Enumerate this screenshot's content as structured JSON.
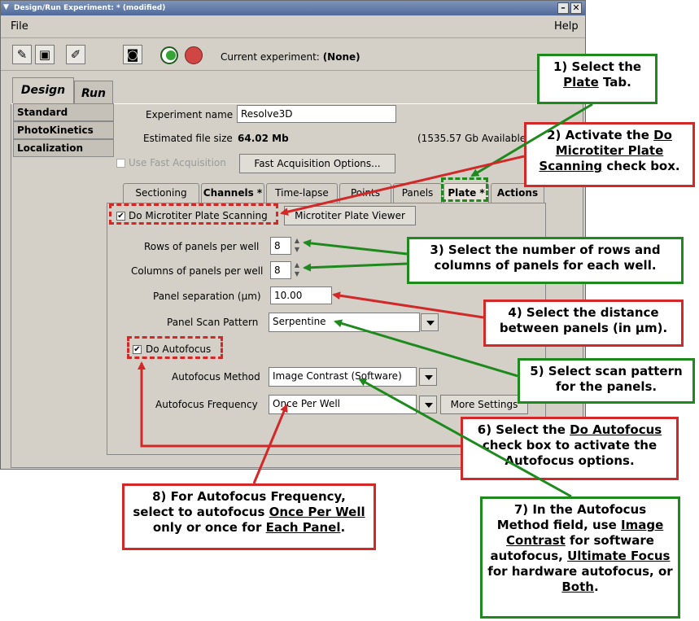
{
  "window": {
    "title": "Design/Run Experiment: * (modified)",
    "minimize": "–",
    "close": "✕"
  },
  "menu": {
    "file": "File",
    "help": "Help"
  },
  "toolbar": {
    "current_experiment_label": "Current experiment:",
    "current_experiment_value": "(None)"
  },
  "top_tabs": [
    "Design",
    "Run"
  ],
  "side_items": [
    "Standard",
    "PhotoKinetics",
    "Localization"
  ],
  "form": {
    "experiment_name_label": "Experiment name",
    "experiment_name_value": "Resolve3D",
    "file_size_label": "Estimated file size",
    "file_size_value": "64.02 Mb",
    "available_value": "(1535.57 Gb Available)",
    "fast_acq_label": "Use Fast Acquisition",
    "fast_acq_button": "Fast Acquisition Options..."
  },
  "inner_tabs": [
    "Sectioning",
    "Channels *",
    "Time-lapse",
    "Points",
    "Panels",
    "Plate *",
    "Actions"
  ],
  "plate": {
    "do_plate_scan_label": "Do Microtiter Plate Scanning",
    "plate_viewer_button": "Microtiter Plate Viewer",
    "rows_label": "Rows of panels per well",
    "rows_value": "8",
    "cols_label": "Columns of panels per well",
    "cols_value": "8",
    "separation_label": "Panel separation (µm)",
    "separation_value": "10.00",
    "scan_pattern_label": "Panel Scan Pattern",
    "scan_pattern_value": "Serpentine",
    "do_autofocus_label": "Do Autofocus",
    "af_method_label": "Autofocus Method",
    "af_method_value": "Image Contrast (Software)",
    "af_freq_label": "Autofocus Frequency",
    "af_freq_value": "Once Per Well",
    "more_settings_button": "More Settings"
  },
  "callouts": {
    "c1": {
      "a": "1) Select the",
      "b": "Plate",
      "c": "Tab."
    },
    "c2": {
      "a": "2) Activate the",
      "b": "Do Microtiter Plate Scanning",
      "c": "check box."
    },
    "c3": {
      "a": "3) Select the number of rows and",
      "b": "columns of panels for each well."
    },
    "c4": {
      "a": "4) Select the distance",
      "b": "between panels (in µm)."
    },
    "c5": {
      "a": "5) Select scan pattern",
      "b": "for the panels."
    },
    "c6": {
      "a": "6) Select the",
      "b": "Do Autofocus",
      "c": "check box to activate the",
      "d": "Autofocus options."
    },
    "c7": {
      "a": "7) In the Autofocus",
      "b": "Method field, use",
      "c": "Image Contrast",
      "d": "for software autofocus,",
      "e": "Ultimate Focus",
      "f": "for hardware autofocus, or",
      "g": "Both",
      "h": "."
    },
    "c8": {
      "a": "8) For Autofocus Frequency,",
      "b": "select to autofocus",
      "c": "Once Per Well",
      "d": "only or once for",
      "e": "Each Panel",
      "f": "."
    }
  },
  "colors": {
    "green": "#1e8a1e",
    "red": "#d22828",
    "window_bg": "#d4d0c8"
  }
}
